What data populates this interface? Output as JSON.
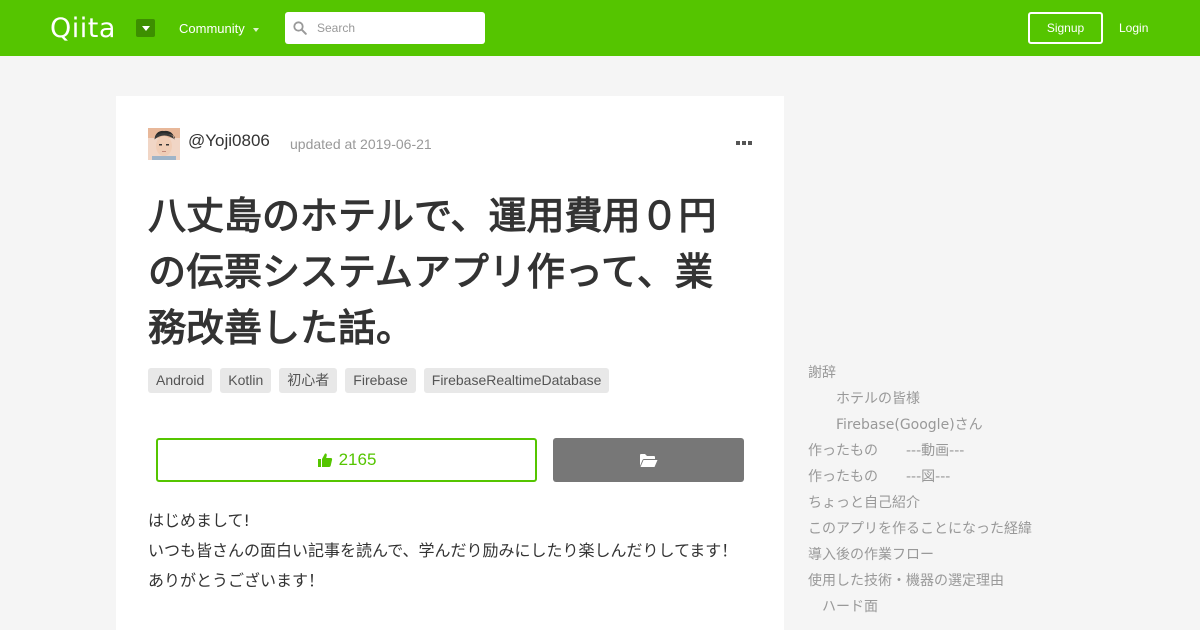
{
  "header": {
    "logo": "Qiita",
    "community_label": "Community",
    "search_placeholder": "Search",
    "signup_label": "Signup",
    "login_label": "Login"
  },
  "article": {
    "author": "@Yoji0806",
    "updated": "updated at 2019-06-21",
    "title": "八丈島のホテルで、運用費用０円の伝票システムアプリ作って、業務改善した話。",
    "tags": [
      "Android",
      "Kotlin",
      "初心者",
      "Firebase",
      "FirebaseRealtimeDatabase"
    ],
    "likes": "2165",
    "body_lines": [
      "はじめまして!",
      "いつも皆さんの面白い記事を読んで、学んだり励みにしたり楽しんだりしてます！",
      "ありがとうございます！"
    ]
  },
  "toc": [
    {
      "label": "謝辞",
      "level": 1
    },
    {
      "label": "ホテルの皆様",
      "level": 2
    },
    {
      "label": "Firebase(Google)さん",
      "level": 2
    },
    {
      "label": "作ったもの　　---動画---",
      "level": 1
    },
    {
      "label": "作ったもの　　---図---",
      "level": 1
    },
    {
      "label": "ちょっと自己紹介",
      "level": 1
    },
    {
      "label": "このアプリを作ることになった経緯",
      "level": 1
    },
    {
      "label": "導入後の作業フロー",
      "level": 1
    },
    {
      "label": "使用した技術・機器の選定理由",
      "level": 1
    },
    {
      "label": "ハード面",
      "level": 3
    }
  ],
  "colors": {
    "brand": "#55c500",
    "stock_button": "#777777"
  }
}
